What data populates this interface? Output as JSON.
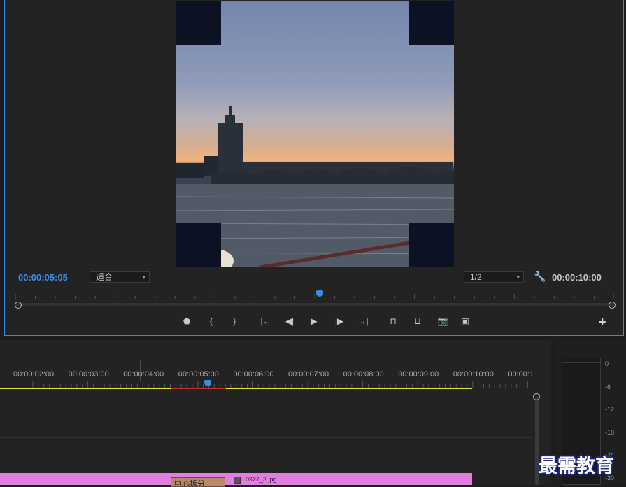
{
  "monitor": {
    "current_time": "00:00:05:05",
    "fit_select": "适合",
    "resolution_select": "1/2",
    "duration": "00:00:10:00",
    "playhead_fraction": 0.5,
    "controls": [
      {
        "name": "add-marker-button",
        "glyph": "⬟"
      },
      {
        "name": "mark-in-button",
        "glyph": "{"
      },
      {
        "name": "mark-out-button",
        "glyph": "}"
      },
      {
        "name": "go-to-in-button",
        "glyph": "|←"
      },
      {
        "name": "step-back-button",
        "glyph": "◀|"
      },
      {
        "name": "play-button",
        "glyph": "▶"
      },
      {
        "name": "step-forward-button",
        "glyph": "|▶"
      },
      {
        "name": "go-to-out-button",
        "glyph": "→|"
      },
      {
        "name": "lift-button",
        "glyph": "⊓"
      },
      {
        "name": "extract-button",
        "glyph": "⊔"
      },
      {
        "name": "export-frame-button",
        "glyph": "📷"
      },
      {
        "name": "compare-view-button",
        "glyph": "▣"
      }
    ],
    "add_button": "+"
  },
  "timeline": {
    "ruler": [
      "00:00:02:00",
      "00:00:03:00",
      "00:00:04:00",
      "00:00:05:00",
      "00:00:06:00",
      "00:00:07:00",
      "00:00:08:00",
      "00:00:09:00",
      "00:00:10:00",
      "00:00:1"
    ],
    "clip_label_a": "中心拆分",
    "clip_label_b": "0927_3.jpg",
    "clip_color": "#e07fe0"
  },
  "meter": {
    "scale": [
      "0",
      "-6",
      "-12",
      "-18",
      "-24",
      "-30"
    ]
  },
  "watermark": "最需教育",
  "colors": {
    "accent": "#2d8ceb",
    "work_area": "#e3e33a",
    "render_red": "#c33030"
  }
}
